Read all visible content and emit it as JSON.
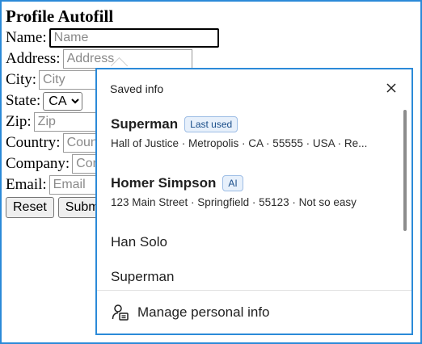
{
  "form": {
    "title": "Profile Autofill",
    "fields": [
      {
        "label": "Name:",
        "placeholder": "Name"
      },
      {
        "label": "Address:",
        "placeholder": "Address"
      },
      {
        "label": "City:",
        "placeholder": "City"
      },
      {
        "label": "State:",
        "value": "CA"
      },
      {
        "label": "Zip:",
        "placeholder": "Zip"
      },
      {
        "label": "Country:",
        "placeholder": "Country"
      },
      {
        "label": "Company:",
        "placeholder": "Company"
      },
      {
        "label": "Email:",
        "placeholder": "Email"
      }
    ],
    "reset_label": "Reset",
    "submit_label": "Submit"
  },
  "popup": {
    "header": "Saved info",
    "close_icon": "close-icon",
    "items": [
      {
        "title": "Superman",
        "badge": "Last used",
        "subtitle": "Hall of Justice · Metropolis · CA · 55555 · USA · Re..."
      },
      {
        "title": "Homer Simpson",
        "badge": "AI",
        "subtitle": "123 Main Street · Springfield · 55123 · Not so easy"
      },
      {
        "title": "Han Solo"
      },
      {
        "title": "Superman"
      }
    ],
    "manage_label": "Manage personal info",
    "manage_icon": "person-id-icon"
  },
  "colors": {
    "accent": "#2b8ad8",
    "badge_bg": "#e7f0fb",
    "badge_text": "#1a4e8a"
  }
}
